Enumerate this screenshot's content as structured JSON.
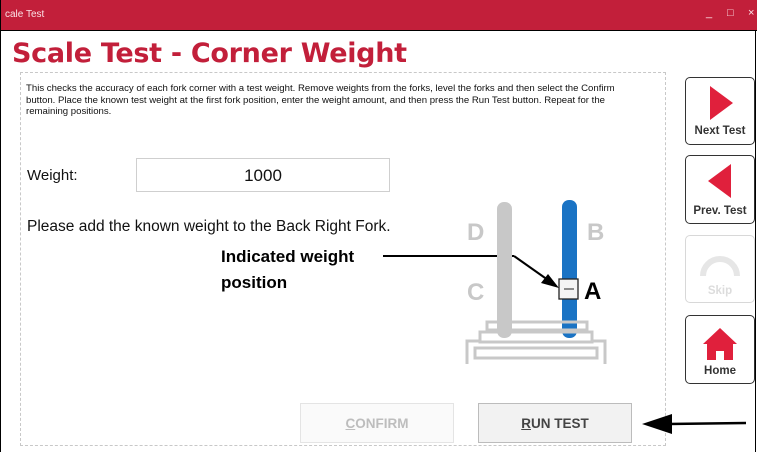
{
  "window": {
    "title": "cale Test",
    "controls": [
      "_",
      "□",
      "×"
    ]
  },
  "page": {
    "title": "Scale Test - Corner Weight"
  },
  "description": "This checks the accuracy of each fork corner with a test weight. Remove weights from the forks, level the forks and then select the Confirm button. Place the known test weight at the first fork position, enter the weight amount, and then press the Run Test button. Repeat for the remaining positions.",
  "weight": {
    "label": "Weight:",
    "value": "1000"
  },
  "instruction": "Please add the known weight to the Back Right Fork.",
  "callout": {
    "line1": "Indicated weight",
    "line2": "position"
  },
  "fork_labels": {
    "d": "D",
    "b": "B",
    "c": "C",
    "a": "A"
  },
  "nav_buttons": {
    "next": {
      "label": "Next Test",
      "icon": "play-right-icon",
      "enabled": true
    },
    "prev": {
      "label": "Prev. Test",
      "icon": "play-left-icon",
      "enabled": true
    },
    "skip": {
      "label": "Skip",
      "icon": "gauge-icon",
      "enabled": false
    },
    "home": {
      "label": "Home",
      "icon": "home-icon",
      "enabled": true
    }
  },
  "actions": {
    "confirm": {
      "key": "C",
      "rest": "ONFIRM",
      "enabled": false
    },
    "run": {
      "key": "R",
      "rest": "UN TEST",
      "enabled": true
    }
  },
  "colors": {
    "brand": "#c21f3a",
    "fork_active": "#1a73c4",
    "fork_inactive": "#c8c8c8"
  }
}
